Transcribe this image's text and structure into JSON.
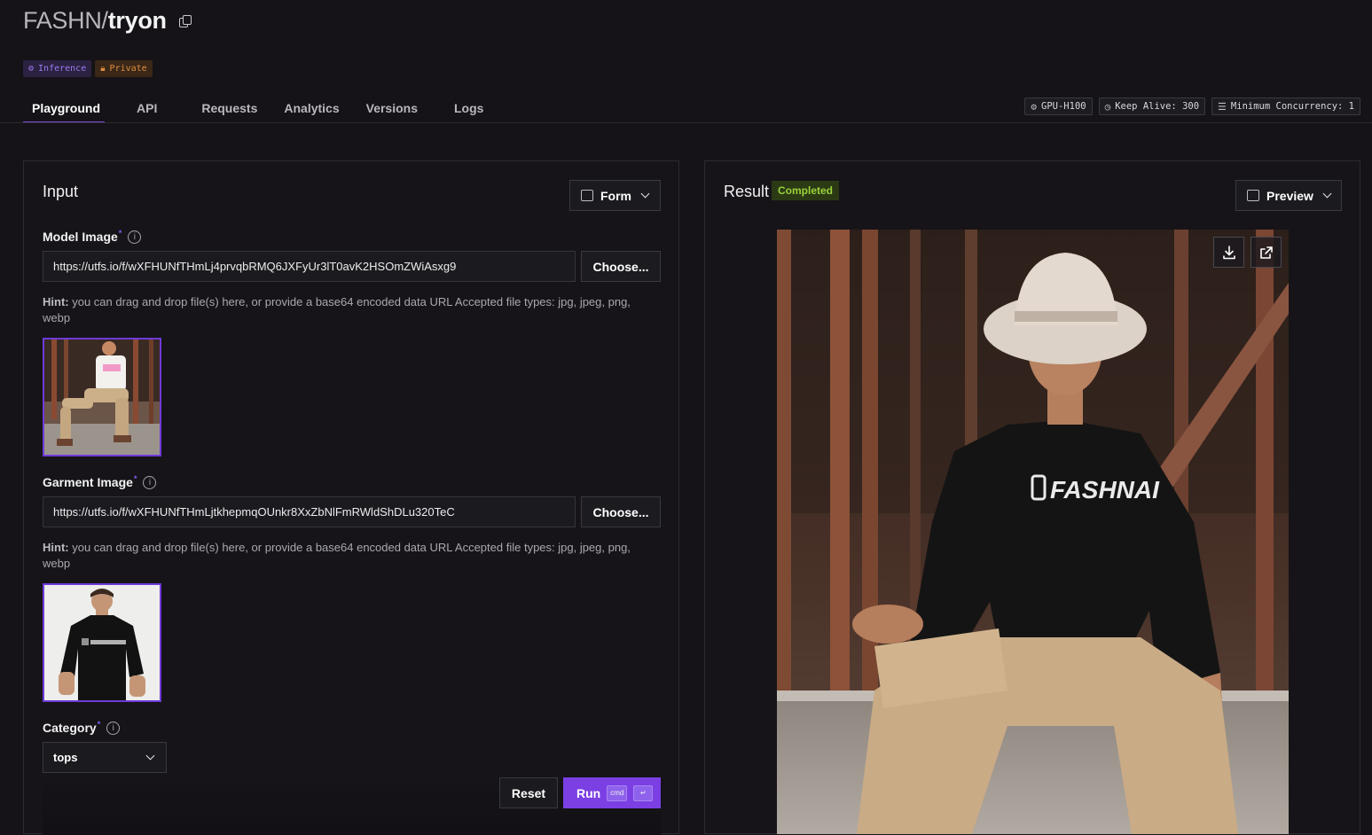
{
  "header": {
    "owner": "FASHN/",
    "model": "tryon",
    "badges": {
      "inference": "Inference",
      "private": "Private"
    }
  },
  "tabs": [
    {
      "label": "Playground",
      "active": true
    },
    {
      "label": "API"
    },
    {
      "label": "Requests"
    },
    {
      "label": "Analytics"
    },
    {
      "label": "Versions"
    },
    {
      "label": "Logs"
    }
  ],
  "infra": {
    "gpu": "GPU-H100",
    "keep_alive": "Keep Alive: 300",
    "concurrency": "Minimum Concurrency: 1"
  },
  "input": {
    "title": "Input",
    "view_mode": "Form",
    "model_image": {
      "label": "Model Image",
      "required_mark": "*",
      "url": "https://utfs.io/f/wXFHUNfTHmLj4prvqbRMQ6JXFyUr3lT0avK2HSOmZWiAsxg9",
      "choose_label": "Choose...",
      "hint_prefix": "Hint:",
      "hint": " you can drag and drop file(s) here, or provide a base64 encoded data URL Accepted file types: jpg, jpeg, png, webp"
    },
    "garment_image": {
      "label": "Garment Image",
      "required_mark": "*",
      "url": "https://utfs.io/f/wXFHUNfTHmLjtkhepmqOUnkr8XxZbNlFmRWldShDLu320TeC",
      "choose_label": "Choose...",
      "hint_prefix": "Hint:",
      "hint": " you can drag and drop file(s) here, or provide a base64 encoded data URL Accepted file types: jpg, jpeg, png, webp"
    },
    "category": {
      "label": "Category",
      "required_mark": "*",
      "value": "tops"
    },
    "reset_label": "Reset",
    "run_label": "Run",
    "run_shortcut": [
      "cmd",
      "↵"
    ]
  },
  "result": {
    "title": "Result",
    "status": "Completed",
    "view_mode": "Preview",
    "garment_logo_text": "FASHNAI"
  },
  "colors": {
    "accent": "#7b3fe4",
    "status_green": "#9bd23a",
    "background": "#151317"
  }
}
